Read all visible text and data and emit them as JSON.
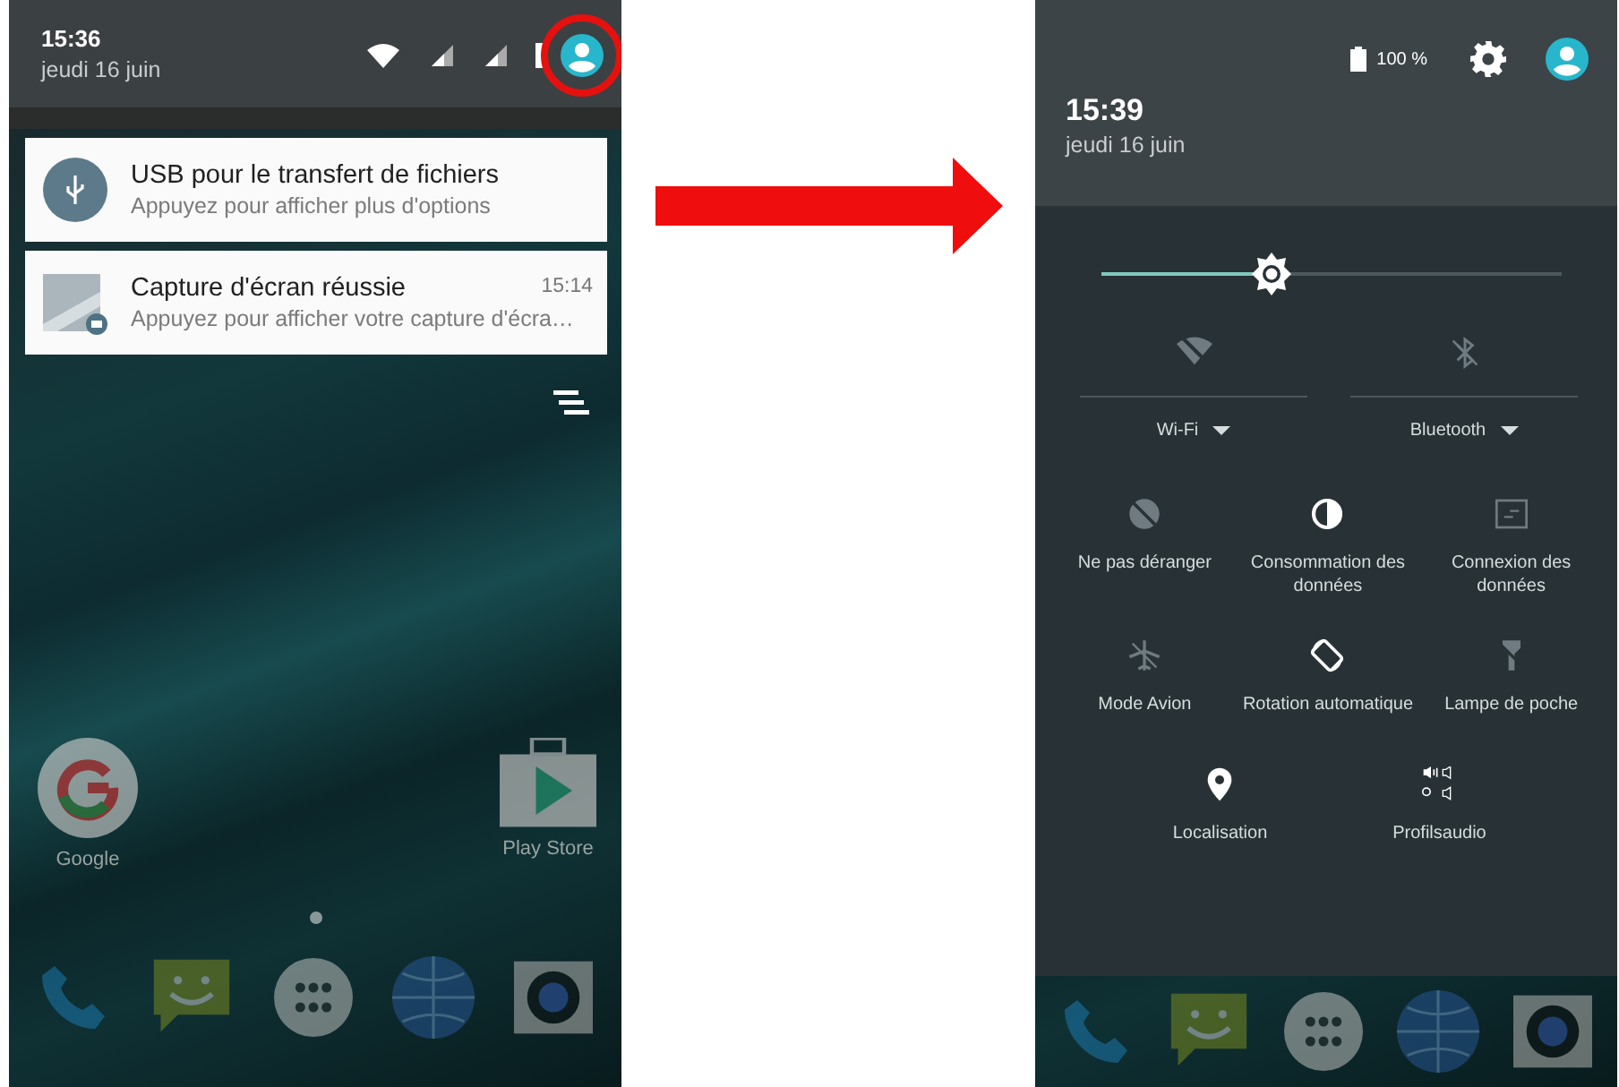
{
  "left_screen": {
    "status_bar": {
      "time": "15:36",
      "date": "jeudi 16 juin"
    },
    "notifications": [
      {
        "kind": "usb",
        "title": "USB pour le transfert de fichiers",
        "text": "Appuyez pour afficher plus d'options"
      },
      {
        "kind": "screenshot",
        "title": "Capture d'écran réussie",
        "time": "15:14",
        "text": "Appuyez pour afficher votre capture d'écra…"
      }
    ],
    "home_apps": [
      {
        "kind": "google",
        "label": "Google"
      },
      {
        "kind": "play-store",
        "label": "Play Store"
      }
    ]
  },
  "right_screen": {
    "header": {
      "battery": "100 %",
      "time": "15:39",
      "date": "jeudi 16 juin"
    },
    "brightness": {
      "level": 0.37
    },
    "toggles": [
      {
        "kind": "wifi",
        "label": "Wi-Fi",
        "on": false
      },
      {
        "kind": "bluetooth",
        "label": "Bluetooth",
        "on": false
      }
    ],
    "tile_rows": [
      [
        {
          "kind": "dnd",
          "label": "Ne pas déranger",
          "on": false
        },
        {
          "kind": "data-usage",
          "label": "Consommation des données",
          "on": true
        },
        {
          "kind": "mobile-data",
          "label": "Connexion des données",
          "on": false
        }
      ],
      [
        {
          "kind": "airplane",
          "label": "Mode Avion",
          "on": false
        },
        {
          "kind": "rotation",
          "label": "Rotation automatique",
          "on": true
        },
        {
          "kind": "flashlight",
          "label": "Lampe de poche",
          "on": false
        }
      ],
      [
        {
          "kind": "location",
          "label": "Localisation",
          "on": true
        },
        {
          "kind": "audio-profile",
          "label": "Profilsaudio",
          "on": true
        }
      ]
    ]
  }
}
